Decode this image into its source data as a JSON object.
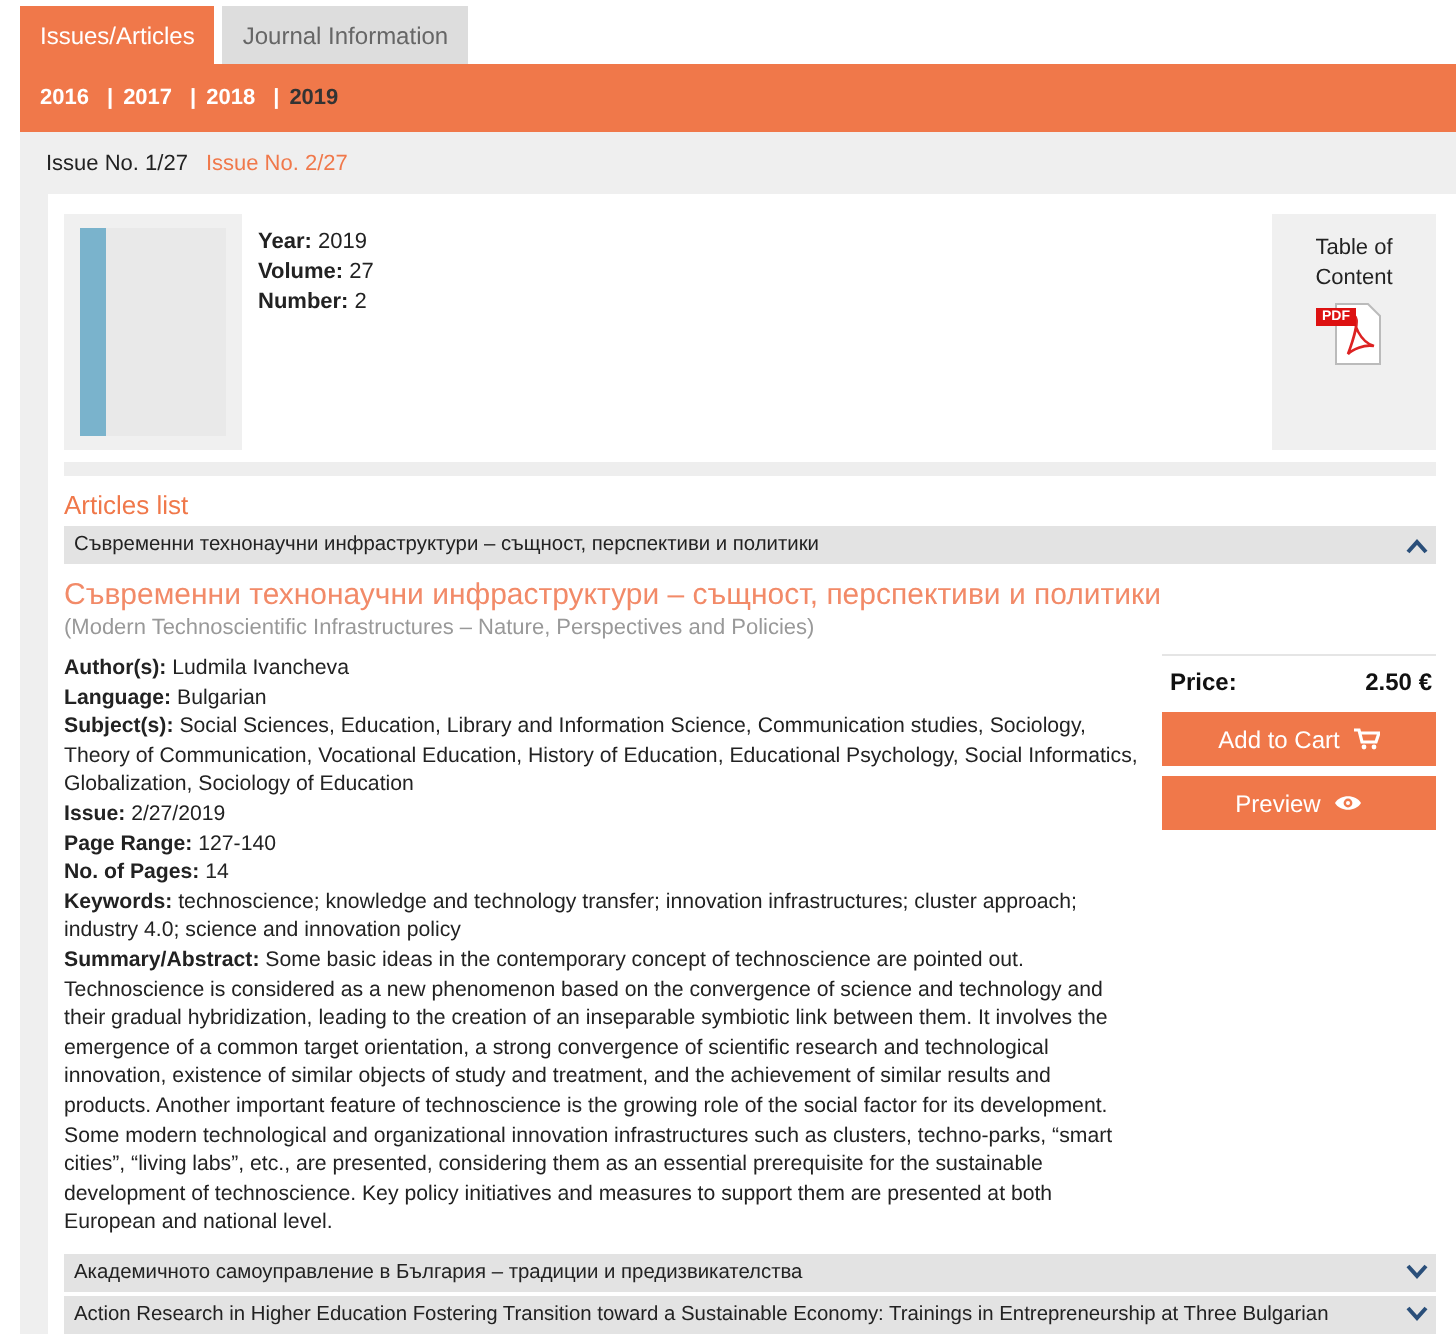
{
  "tabs": [
    {
      "label": "Issues/Articles",
      "selected": true
    },
    {
      "label": "Journal Information",
      "selected": false
    }
  ],
  "year_separator": "|",
  "years": [
    {
      "label": "2016",
      "selected": false
    },
    {
      "label": "2017",
      "selected": false
    },
    {
      "label": "2018",
      "selected": false
    },
    {
      "label": "2019",
      "selected": true
    }
  ],
  "issues": [
    {
      "label": "Issue No. 1/27",
      "selected": false
    },
    {
      "label": "Issue No. 2/27",
      "selected": true
    }
  ],
  "issue_info": {
    "fields": [
      "**Year:** 2019",
      "**Volume:** 27",
      "**Number:** 2"
    ],
    "toc_label": "Table of Content",
    "pdf_label": "PDF"
  },
  "articles_heading": "Articles list",
  "articles": [
    {
      "title": "Съвременни технонаучни инфраструктури – същност, перспективи и политики",
      "expanded": true,
      "detail": {
        "title": "Съвременни технонаучни инфраструктури – същност, перспективи и политики",
        "subtitle": "(Modern Technoscientific Infrastructures – Nature, Perspectives and Policies)",
        "fields": [
          "**Author(s):** Ludmila Ivancheva",
          "**Language:** Bulgarian",
          "**Subject(s):** Social Sciences, Education, Library and Information Science, Communication studies, Sociology, Theory of Communication, Vocational Education, History of Education, Educational Psychology, Social Informatics, Globalization, Sociology of Education",
          "**Issue:** 2/27/2019",
          "**Page Range:** 127-140",
          "**No. of Pages:** 14",
          "**Keywords:** technoscience; knowledge and technology transfer; innovation infrastructures; cluster approach; industry 4.0; science and innovation policy",
          "**Summary/Abstract:** Some basic ideas in the contemporary concept of technoscience are pointed out. Technoscience is considered as a new phenomenon based on the convergence of science and technology and their gradual hybridization, leading to the creation of an inseparable symbiotic link between them. It involves the emergence of a common target orientation, a strong convergence of scientific research and technological innovation, existence of similar objects of study and treatment, and the achievement of similar results and products. Another important feature of technoscience is the growing role of the social factor for its development. Some modern technological and organizational innovation infrastructures such as clusters, techno-parks, “smart cities”, “living labs”, etc., are presented, considering them as an essential prerequisite for the sustainable development of technoscience. Key policy initiatives and measures to support them are presented at both European and national level."
        ],
        "price_label": "Price:",
        "price": "2.50 €",
        "buttons": [
          {
            "label": "Add to Cart",
            "kind": "cart"
          },
          {
            "label": "Preview",
            "kind": "preview"
          }
        ]
      }
    },
    {
      "title": "Академичното самоуправление в България – традиции и предизвикателства",
      "expanded": false
    },
    {
      "title": "Action Research in Higher Education Fostering Transition toward a Sustainable Economy: Trainings in Entrepreneurship at Three Bulgarian",
      "expanded": false
    }
  ]
}
